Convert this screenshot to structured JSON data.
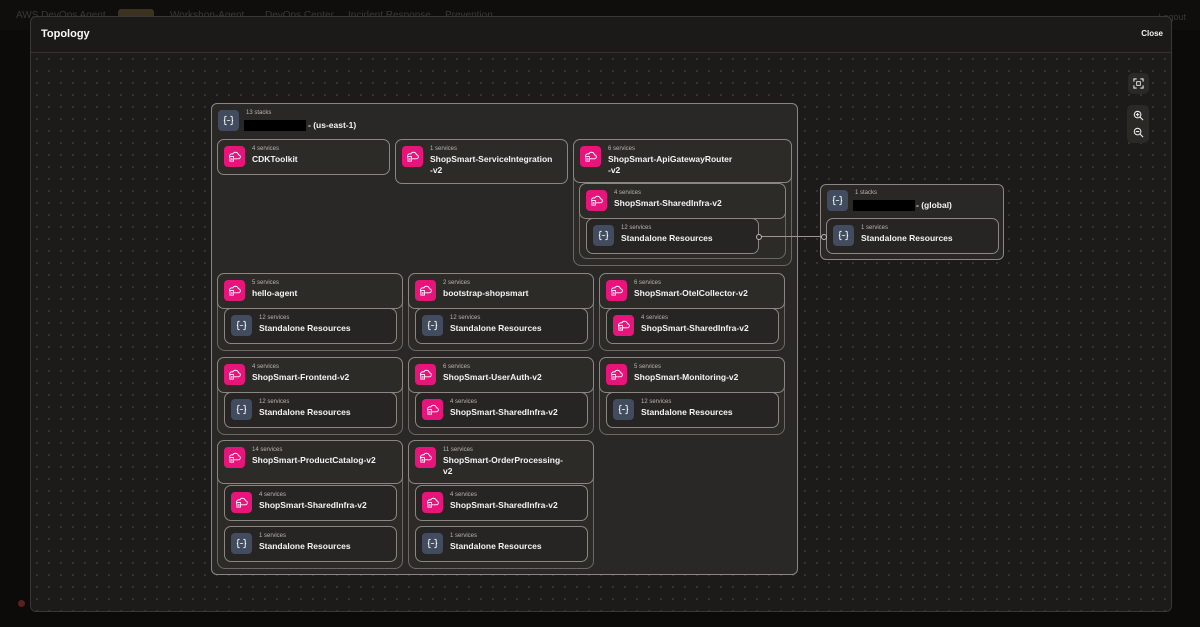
{
  "background": {
    "brand": "AWS DevOps Agent",
    "nav": [
      "Workshop-Agent",
      "DevOps Center",
      "Incident Response",
      "Prevention"
    ],
    "logout": "Logout"
  },
  "modal": {
    "title": "Topology",
    "close_label": "Close"
  },
  "icons": {
    "cloudformation": "cloudformation-stack-icon",
    "standalone": "braces-icon",
    "fit": "fit-view-icon",
    "zoom_in": "zoom-in-icon",
    "zoom_out": "zoom-out-icon"
  },
  "colors": {
    "accent_pink": "#e7157b",
    "slate": "#414c5e"
  },
  "account_region": {
    "count": "13 stacks",
    "suffix": "- (us-east-1)"
  },
  "account_global": {
    "count": "1 stacks",
    "suffix": "- (global)"
  },
  "nodes": {
    "cdk": {
      "count": "4 services",
      "name": "CDKToolkit"
    },
    "svcint": {
      "count": "1 services",
      "name": "ShopSmart-ServiceIntegration\n-v2"
    },
    "apigw": {
      "count": "6 services",
      "name": "ShopSmart-ApiGatewayRouter\n-v2"
    },
    "apigw_shared": {
      "count": "4 services",
      "name": "ShopSmart-SharedInfra-v2"
    },
    "apigw_shared_sa": {
      "count": "12 services",
      "name": "Standalone Resources"
    },
    "global_sa": {
      "count": "1 services",
      "name": "Standalone Resources"
    },
    "hello": {
      "count": "5 services",
      "name": "hello-agent"
    },
    "hello_sa": {
      "count": "12 services",
      "name": "Standalone Resources"
    },
    "boot": {
      "count": "2 services",
      "name": "bootstrap-shopsmart"
    },
    "boot_sa": {
      "count": "12 services",
      "name": "Standalone Resources"
    },
    "otel": {
      "count": "6 services",
      "name": "ShopSmart-OtelCollector-v2"
    },
    "otel_shared": {
      "count": "4 services",
      "name": "ShopSmart-SharedInfra-v2"
    },
    "front": {
      "count": "4 services",
      "name": "ShopSmart-Frontend-v2"
    },
    "front_sa": {
      "count": "12 services",
      "name": "Standalone Resources"
    },
    "auth": {
      "count": "6 services",
      "name": "ShopSmart-UserAuth-v2"
    },
    "auth_shared": {
      "count": "4 services",
      "name": "ShopSmart-SharedInfra-v2"
    },
    "mon": {
      "count": "5 services",
      "name": "ShopSmart-Monitoring-v2"
    },
    "mon_sa": {
      "count": "12 services",
      "name": "Standalone Resources"
    },
    "cat": {
      "count": "14 services",
      "name": "ShopSmart-ProductCatalog-v2"
    },
    "cat_shared": {
      "count": "4 services",
      "name": "ShopSmart-SharedInfra-v2"
    },
    "cat_sa": {
      "count": "1 services",
      "name": "Standalone Resources"
    },
    "ord": {
      "count": "11 services",
      "name": "ShopSmart-OrderProcessing-\nv2"
    },
    "ord_shared": {
      "count": "4 services",
      "name": "ShopSmart-SharedInfra-v2"
    },
    "ord_sa": {
      "count": "1 services",
      "name": "Standalone Resources"
    }
  }
}
